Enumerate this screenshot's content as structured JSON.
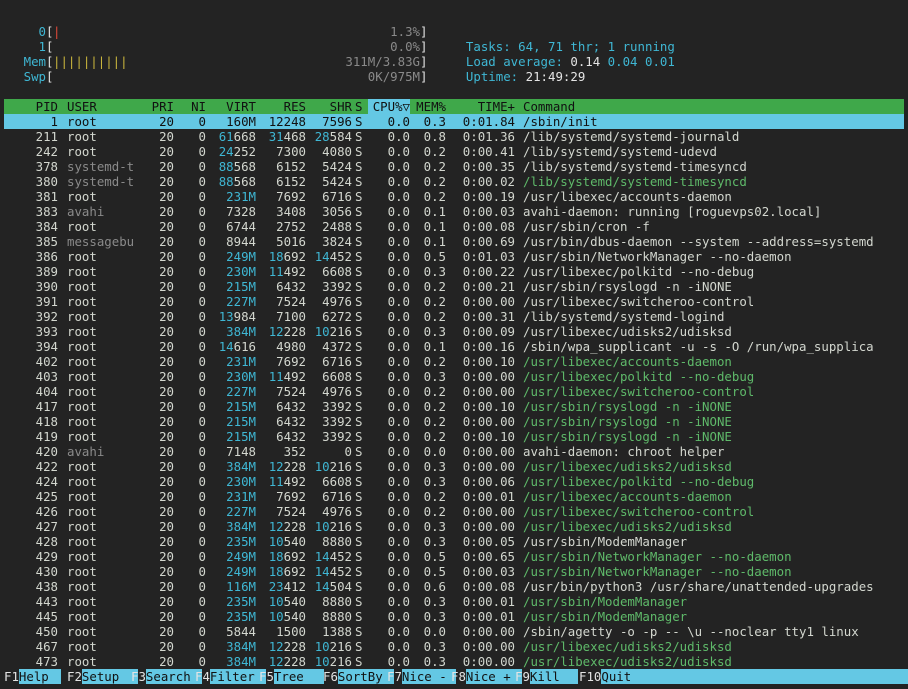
{
  "meters": {
    "cpu": {
      "label": "0",
      "open": "[",
      "bar": "|",
      "value": "1.3%",
      "close": "]"
    },
    "cpu1": {
      "label": "1",
      "open": "[",
      "bar": "",
      "value": "0.0%",
      "close": "]"
    },
    "mem": {
      "label": "Mem",
      "open": "[",
      "bar": "||||||||||",
      "value": "311M/3.83G",
      "close": "]"
    },
    "swp": {
      "label": "Swp",
      "open": "[",
      "bar": "",
      "value": "0K/975M",
      "close": "]"
    }
  },
  "stats": {
    "tasks_label": "Tasks: ",
    "tasks": "64",
    "thr_sep": ", ",
    "threads": "71",
    "thr_label": " thr; ",
    "running": "1",
    "running_label": " running",
    "load_label": "Load average: ",
    "load1": "0.14",
    "load5": "0.04",
    "load15": "0.01",
    "uptime_label": "Uptime: ",
    "uptime": "21:49:29"
  },
  "columns": {
    "pid": "PID",
    "user": "USER",
    "pri": "PRI",
    "ni": "NI",
    "virt": "VIRT",
    "res": "RES",
    "shr": "SHR",
    "s": "S",
    "cpu": "CPU%▽",
    "mem": "MEM%",
    "time": "TIME+",
    "command": "Command"
  },
  "colors": {
    "header_bg": "#3fa84a",
    "selected_bg": "#64c8e4",
    "thread_green": "#5fba6a",
    "cyan": "#3fb7d4"
  },
  "processes": [
    {
      "pid": "1",
      "user": "root",
      "pri": "20",
      "ni": "0",
      "virt": "160M",
      "res": "12248",
      "shr": "7596",
      "s": "S",
      "cpu": "0.0",
      "mem": "0.3",
      "time": "0:01.84",
      "command": "/sbin/init",
      "kind": "selected"
    },
    {
      "pid": "211",
      "user": "root",
      "pri": "20",
      "ni": "0",
      "virt": "61668",
      "res": "31468",
      "shr": "28584",
      "s": "S",
      "cpu": "0.0",
      "mem": "0.8",
      "time": "0:01.36",
      "command": "/lib/systemd/systemd-journald",
      "kind": "proc"
    },
    {
      "pid": "242",
      "user": "root",
      "pri": "20",
      "ni": "0",
      "virt": "24252",
      "res": "7300",
      "shr": "4080",
      "s": "S",
      "cpu": "0.0",
      "mem": "0.2",
      "time": "0:00.41",
      "command": "/lib/systemd/systemd-udevd",
      "kind": "proc"
    },
    {
      "pid": "378",
      "user": "systemd-t",
      "pri": "20",
      "ni": "0",
      "virt": "88568",
      "res": "6152",
      "shr": "5424",
      "s": "S",
      "cpu": "0.0",
      "mem": "0.2",
      "time": "0:00.35",
      "command": "/lib/systemd/systemd-timesyncd",
      "kind": "proc"
    },
    {
      "pid": "380",
      "user": "systemd-t",
      "pri": "20",
      "ni": "0",
      "virt": "88568",
      "res": "6152",
      "shr": "5424",
      "s": "S",
      "cpu": "0.0",
      "mem": "0.2",
      "time": "0:00.02",
      "command": "/lib/systemd/systemd-timesyncd",
      "kind": "thread"
    },
    {
      "pid": "381",
      "user": "root",
      "pri": "20",
      "ni": "0",
      "virt": "231M",
      "res": "7692",
      "shr": "6716",
      "s": "S",
      "cpu": "0.0",
      "mem": "0.2",
      "time": "0:00.19",
      "command": "/usr/libexec/accounts-daemon",
      "kind": "proc"
    },
    {
      "pid": "383",
      "user": "avahi",
      "pri": "20",
      "ni": "0",
      "virt": "7328",
      "res": "3408",
      "shr": "3056",
      "s": "S",
      "cpu": "0.0",
      "mem": "0.1",
      "time": "0:00.03",
      "command": "avahi-daemon: running [roguevps02.local]",
      "kind": "proc"
    },
    {
      "pid": "384",
      "user": "root",
      "pri": "20",
      "ni": "0",
      "virt": "6744",
      "res": "2752",
      "shr": "2488",
      "s": "S",
      "cpu": "0.0",
      "mem": "0.1",
      "time": "0:00.08",
      "command": "/usr/sbin/cron -f",
      "kind": "proc"
    },
    {
      "pid": "385",
      "user": "messagebu",
      "pri": "20",
      "ni": "0",
      "virt": "8944",
      "res": "5016",
      "shr": "3824",
      "s": "S",
      "cpu": "0.0",
      "mem": "0.1",
      "time": "0:00.69",
      "command": "/usr/bin/dbus-daemon --system --address=systemd",
      "kind": "proc"
    },
    {
      "pid": "386",
      "user": "root",
      "pri": "20",
      "ni": "0",
      "virt": "249M",
      "res": "18692",
      "shr": "14452",
      "s": "S",
      "cpu": "0.0",
      "mem": "0.5",
      "time": "0:01.03",
      "command": "/usr/sbin/NetworkManager --no-daemon",
      "kind": "proc"
    },
    {
      "pid": "389",
      "user": "root",
      "pri": "20",
      "ni": "0",
      "virt": "230M",
      "res": "11492",
      "shr": "6608",
      "s": "S",
      "cpu": "0.0",
      "mem": "0.3",
      "time": "0:00.22",
      "command": "/usr/libexec/polkitd --no-debug",
      "kind": "proc"
    },
    {
      "pid": "390",
      "user": "root",
      "pri": "20",
      "ni": "0",
      "virt": "215M",
      "res": "6432",
      "shr": "3392",
      "s": "S",
      "cpu": "0.0",
      "mem": "0.2",
      "time": "0:00.21",
      "command": "/usr/sbin/rsyslogd -n -iNONE",
      "kind": "proc"
    },
    {
      "pid": "391",
      "user": "root",
      "pri": "20",
      "ni": "0",
      "virt": "227M",
      "res": "7524",
      "shr": "4976",
      "s": "S",
      "cpu": "0.0",
      "mem": "0.2",
      "time": "0:00.00",
      "command": "/usr/libexec/switcheroo-control",
      "kind": "proc"
    },
    {
      "pid": "392",
      "user": "root",
      "pri": "20",
      "ni": "0",
      "virt": "13984",
      "res": "7100",
      "shr": "6272",
      "s": "S",
      "cpu": "0.0",
      "mem": "0.2",
      "time": "0:00.31",
      "command": "/lib/systemd/systemd-logind",
      "kind": "proc"
    },
    {
      "pid": "393",
      "user": "root",
      "pri": "20",
      "ni": "0",
      "virt": "384M",
      "res": "12228",
      "shr": "10216",
      "s": "S",
      "cpu": "0.0",
      "mem": "0.3",
      "time": "0:00.09",
      "command": "/usr/libexec/udisks2/udisksd",
      "kind": "proc"
    },
    {
      "pid": "394",
      "user": "root",
      "pri": "20",
      "ni": "0",
      "virt": "14616",
      "res": "4980",
      "shr": "4372",
      "s": "S",
      "cpu": "0.0",
      "mem": "0.1",
      "time": "0:00.16",
      "command": "/sbin/wpa_supplicant -u -s -O /run/wpa_supplica",
      "kind": "proc"
    },
    {
      "pid": "402",
      "user": "root",
      "pri": "20",
      "ni": "0",
      "virt": "231M",
      "res": "7692",
      "shr": "6716",
      "s": "S",
      "cpu": "0.0",
      "mem": "0.2",
      "time": "0:00.10",
      "command": "/usr/libexec/accounts-daemon",
      "kind": "thread"
    },
    {
      "pid": "403",
      "user": "root",
      "pri": "20",
      "ni": "0",
      "virt": "230M",
      "res": "11492",
      "shr": "6608",
      "s": "S",
      "cpu": "0.0",
      "mem": "0.3",
      "time": "0:00.00",
      "command": "/usr/libexec/polkitd --no-debug",
      "kind": "thread"
    },
    {
      "pid": "404",
      "user": "root",
      "pri": "20",
      "ni": "0",
      "virt": "227M",
      "res": "7524",
      "shr": "4976",
      "s": "S",
      "cpu": "0.0",
      "mem": "0.2",
      "time": "0:00.00",
      "command": "/usr/libexec/switcheroo-control",
      "kind": "thread"
    },
    {
      "pid": "417",
      "user": "root",
      "pri": "20",
      "ni": "0",
      "virt": "215M",
      "res": "6432",
      "shr": "3392",
      "s": "S",
      "cpu": "0.0",
      "mem": "0.2",
      "time": "0:00.10",
      "command": "/usr/sbin/rsyslogd -n -iNONE",
      "kind": "thread"
    },
    {
      "pid": "418",
      "user": "root",
      "pri": "20",
      "ni": "0",
      "virt": "215M",
      "res": "6432",
      "shr": "3392",
      "s": "S",
      "cpu": "0.0",
      "mem": "0.2",
      "time": "0:00.00",
      "command": "/usr/sbin/rsyslogd -n -iNONE",
      "kind": "thread"
    },
    {
      "pid": "419",
      "user": "root",
      "pri": "20",
      "ni": "0",
      "virt": "215M",
      "res": "6432",
      "shr": "3392",
      "s": "S",
      "cpu": "0.0",
      "mem": "0.2",
      "time": "0:00.10",
      "command": "/usr/sbin/rsyslogd -n -iNONE",
      "kind": "thread"
    },
    {
      "pid": "420",
      "user": "avahi",
      "pri": "20",
      "ni": "0",
      "virt": "7148",
      "res": "352",
      "shr": "0",
      "s": "S",
      "cpu": "0.0",
      "mem": "0.0",
      "time": "0:00.00",
      "command": "avahi-daemon: chroot helper",
      "kind": "proc"
    },
    {
      "pid": "422",
      "user": "root",
      "pri": "20",
      "ni": "0",
      "virt": "384M",
      "res": "12228",
      "shr": "10216",
      "s": "S",
      "cpu": "0.0",
      "mem": "0.3",
      "time": "0:00.00",
      "command": "/usr/libexec/udisks2/udisksd",
      "kind": "thread"
    },
    {
      "pid": "424",
      "user": "root",
      "pri": "20",
      "ni": "0",
      "virt": "230M",
      "res": "11492",
      "shr": "6608",
      "s": "S",
      "cpu": "0.0",
      "mem": "0.3",
      "time": "0:00.06",
      "command": "/usr/libexec/polkitd --no-debug",
      "kind": "thread"
    },
    {
      "pid": "425",
      "user": "root",
      "pri": "20",
      "ni": "0",
      "virt": "231M",
      "res": "7692",
      "shr": "6716",
      "s": "S",
      "cpu": "0.0",
      "mem": "0.2",
      "time": "0:00.01",
      "command": "/usr/libexec/accounts-daemon",
      "kind": "thread"
    },
    {
      "pid": "426",
      "user": "root",
      "pri": "20",
      "ni": "0",
      "virt": "227M",
      "res": "7524",
      "shr": "4976",
      "s": "S",
      "cpu": "0.0",
      "mem": "0.2",
      "time": "0:00.00",
      "command": "/usr/libexec/switcheroo-control",
      "kind": "thread"
    },
    {
      "pid": "427",
      "user": "root",
      "pri": "20",
      "ni": "0",
      "virt": "384M",
      "res": "12228",
      "shr": "10216",
      "s": "S",
      "cpu": "0.0",
      "mem": "0.3",
      "time": "0:00.00",
      "command": "/usr/libexec/udisks2/udisksd",
      "kind": "thread"
    },
    {
      "pid": "428",
      "user": "root",
      "pri": "20",
      "ni": "0",
      "virt": "235M",
      "res": "10540",
      "shr": "8880",
      "s": "S",
      "cpu": "0.0",
      "mem": "0.3",
      "time": "0:00.05",
      "command": "/usr/sbin/ModemManager",
      "kind": "proc"
    },
    {
      "pid": "429",
      "user": "root",
      "pri": "20",
      "ni": "0",
      "virt": "249M",
      "res": "18692",
      "shr": "14452",
      "s": "S",
      "cpu": "0.0",
      "mem": "0.5",
      "time": "0:00.65",
      "command": "/usr/sbin/NetworkManager --no-daemon",
      "kind": "thread"
    },
    {
      "pid": "430",
      "user": "root",
      "pri": "20",
      "ni": "0",
      "virt": "249M",
      "res": "18692",
      "shr": "14452",
      "s": "S",
      "cpu": "0.0",
      "mem": "0.5",
      "time": "0:00.03",
      "command": "/usr/sbin/NetworkManager --no-daemon",
      "kind": "thread"
    },
    {
      "pid": "438",
      "user": "root",
      "pri": "20",
      "ni": "0",
      "virt": "116M",
      "res": "23412",
      "shr": "14504",
      "s": "S",
      "cpu": "0.0",
      "mem": "0.6",
      "time": "0:00.08",
      "command": "/usr/bin/python3 /usr/share/unattended-upgrades",
      "kind": "proc"
    },
    {
      "pid": "443",
      "user": "root",
      "pri": "20",
      "ni": "0",
      "virt": "235M",
      "res": "10540",
      "shr": "8880",
      "s": "S",
      "cpu": "0.0",
      "mem": "0.3",
      "time": "0:00.01",
      "command": "/usr/sbin/ModemManager",
      "kind": "thread"
    },
    {
      "pid": "445",
      "user": "root",
      "pri": "20",
      "ni": "0",
      "virt": "235M",
      "res": "10540",
      "shr": "8880",
      "s": "S",
      "cpu": "0.0",
      "mem": "0.3",
      "time": "0:00.01",
      "command": "/usr/sbin/ModemManager",
      "kind": "thread"
    },
    {
      "pid": "450",
      "user": "root",
      "pri": "20",
      "ni": "0",
      "virt": "5844",
      "res": "1500",
      "shr": "1388",
      "s": "S",
      "cpu": "0.0",
      "mem": "0.0",
      "time": "0:00.00",
      "command": "/sbin/agetty -o -p -- \\u --noclear tty1 linux",
      "kind": "proc"
    },
    {
      "pid": "467",
      "user": "root",
      "pri": "20",
      "ni": "0",
      "virt": "384M",
      "res": "12228",
      "shr": "10216",
      "s": "S",
      "cpu": "0.0",
      "mem": "0.3",
      "time": "0:00.00",
      "command": "/usr/libexec/udisks2/udisksd",
      "kind": "thread"
    },
    {
      "pid": "473",
      "user": "root",
      "pri": "20",
      "ni": "0",
      "virt": "384M",
      "res": "12228",
      "shr": "10216",
      "s": "S",
      "cpu": "0.0",
      "mem": "0.3",
      "time": "0:00.00",
      "command": "/usr/libexec/udisks2/udisksd",
      "kind": "thread"
    }
  ],
  "function_keys": [
    {
      "key": "F1",
      "label": "Help"
    },
    {
      "key": "F2",
      "label": "Setup"
    },
    {
      "key": "F3",
      "label": "Search"
    },
    {
      "key": "F4",
      "label": "Filter"
    },
    {
      "key": "F5",
      "label": "Tree"
    },
    {
      "key": "F6",
      "label": "SortBy"
    },
    {
      "key": "F7",
      "label": "Nice -"
    },
    {
      "key": "F8",
      "label": "Nice +"
    },
    {
      "key": "F9",
      "label": "Kill"
    },
    {
      "key": "F10",
      "label": "Quit"
    }
  ]
}
